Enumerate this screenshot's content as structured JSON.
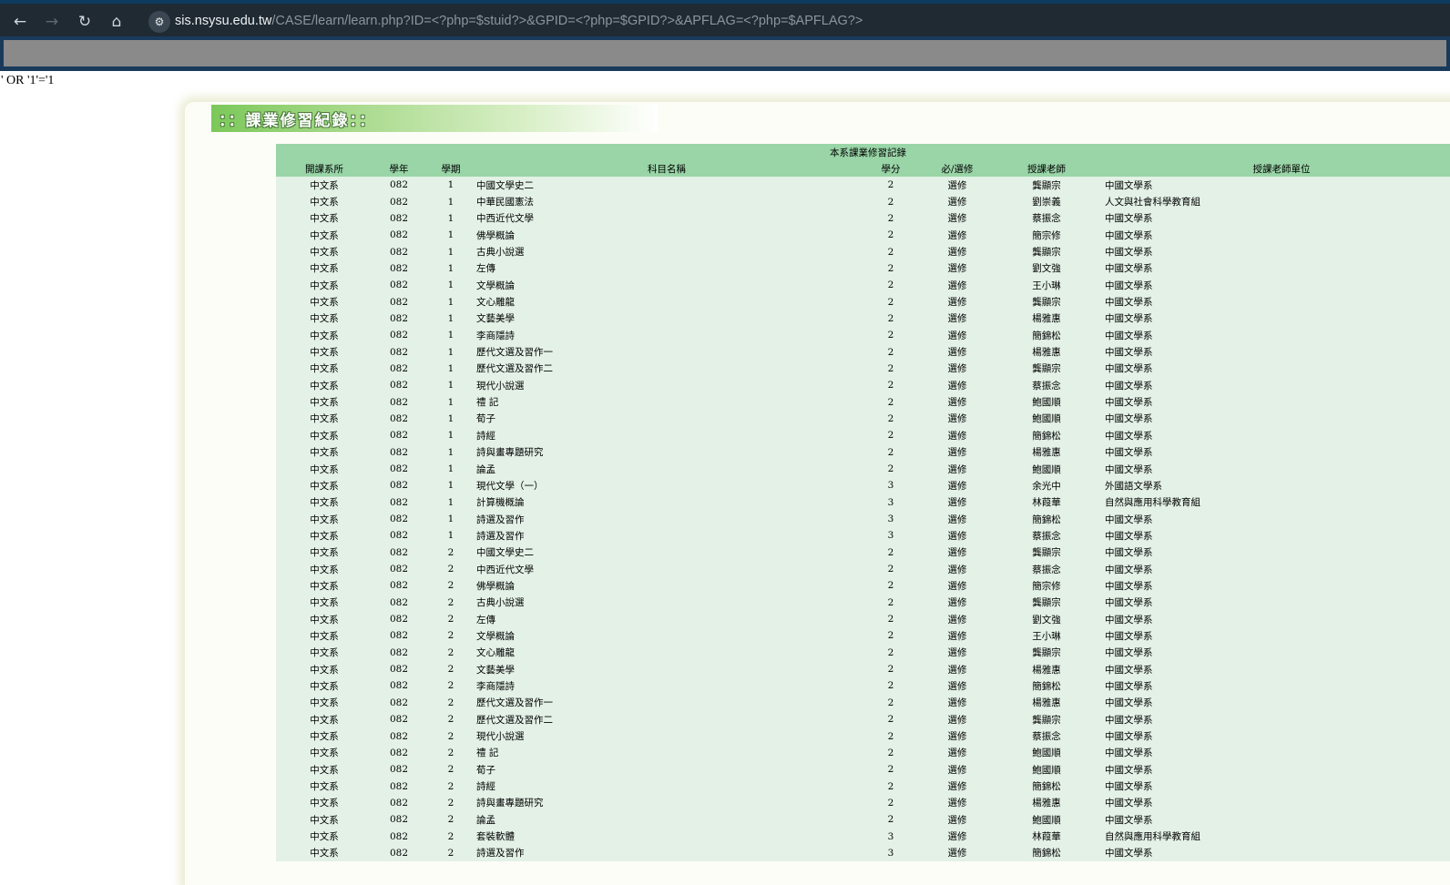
{
  "browser": {
    "url_host": "sis.nsysu.edu.tw",
    "url_path": "/CASE/learn/learn.php?ID=<?php=$stuid?>&GPID=<?php=$GPID?>&APFLAG=<?php=$APFLAG?>",
    "icons": [
      "back-arrow-icon",
      "forward-arrow-icon",
      "reload-icon",
      "home-icon",
      "site-settings-icon"
    ]
  },
  "page": {
    "sql_text": "' OR '1'='1",
    "banner_title": "：：課業修習紀錄：："
  },
  "table": {
    "caption": "本系課業修習記錄",
    "headers": [
      "開課系所",
      "學年",
      "學期",
      "科目名稱",
      "學分",
      "必/選修",
      "授課老師",
      "授課老師單位"
    ],
    "rows": [
      [
        "中文系",
        "082",
        "1",
        "中國文學史二",
        "2",
        "選修",
        "龔顯宗",
        "中國文學系"
      ],
      [
        "中文系",
        "082",
        "1",
        "中華民國憲法",
        "2",
        "選修",
        "劉崇義",
        "人文與社會科學教育組"
      ],
      [
        "中文系",
        "082",
        "1",
        "中西近代文學",
        "2",
        "選修",
        "蔡振念",
        "中國文學系"
      ],
      [
        "中文系",
        "082",
        "1",
        "佛學概論",
        "2",
        "選修",
        "簡宗修",
        "中國文學系"
      ],
      [
        "中文系",
        "082",
        "1",
        "古典小說選",
        "2",
        "選修",
        "龔顯宗",
        "中國文學系"
      ],
      [
        "中文系",
        "082",
        "1",
        "左傳",
        "2",
        "選修",
        "劉文強",
        "中國文學系"
      ],
      [
        "中文系",
        "082",
        "1",
        "文學概論",
        "2",
        "選修",
        "王小琳",
        "中國文學系"
      ],
      [
        "中文系",
        "082",
        "1",
        "文心雕龍",
        "2",
        "選修",
        "龔顯宗",
        "中國文學系"
      ],
      [
        "中文系",
        "082",
        "1",
        "文藝美學",
        "2",
        "選修",
        "楊雅惠",
        "中國文學系"
      ],
      [
        "中文系",
        "082",
        "1",
        "李商隱詩",
        "2",
        "選修",
        "簡錦松",
        "中國文學系"
      ],
      [
        "中文系",
        "082",
        "1",
        "歷代文選及習作一",
        "2",
        "選修",
        "楊雅惠",
        "中國文學系"
      ],
      [
        "中文系",
        "082",
        "1",
        "歷代文選及習作二",
        "2",
        "選修",
        "龔顯宗",
        "中國文學系"
      ],
      [
        "中文系",
        "082",
        "1",
        "現代小說選",
        "2",
        "選修",
        "蔡振念",
        "中國文學系"
      ],
      [
        "中文系",
        "082",
        "1",
        "禮 記",
        "2",
        "選修",
        "鮑國順",
        "中國文學系"
      ],
      [
        "中文系",
        "082",
        "1",
        "荀子",
        "2",
        "選修",
        "鮑國順",
        "中國文學系"
      ],
      [
        "中文系",
        "082",
        "1",
        "詩經",
        "2",
        "選修",
        "簡錦松",
        "中國文學系"
      ],
      [
        "中文系",
        "082",
        "1",
        "詩與畫專題研究",
        "2",
        "選修",
        "楊雅惠",
        "中國文學系"
      ],
      [
        "中文系",
        "082",
        "1",
        "論孟",
        "2",
        "選修",
        "鮑國順",
        "中國文學系"
      ],
      [
        "中文系",
        "082",
        "1",
        "現代文學（一）",
        "3",
        "選修",
        "余光中",
        "外國語文學系"
      ],
      [
        "中文系",
        "082",
        "1",
        "計算機概論",
        "3",
        "選修",
        "林葭華",
        "自然與應用科學教育組"
      ],
      [
        "中文系",
        "082",
        "1",
        "詩選及習作",
        "3",
        "選修",
        "簡錦松",
        "中國文學系"
      ],
      [
        "中文系",
        "082",
        "1",
        "詩選及習作",
        "3",
        "選修",
        "蔡振念",
        "中國文學系"
      ],
      [
        "中文系",
        "082",
        "2",
        "中國文學史二",
        "2",
        "選修",
        "龔顯宗",
        "中國文學系"
      ],
      [
        "中文系",
        "082",
        "2",
        "中西近代文學",
        "2",
        "選修",
        "蔡振念",
        "中國文學系"
      ],
      [
        "中文系",
        "082",
        "2",
        "佛學概論",
        "2",
        "選修",
        "簡宗修",
        "中國文學系"
      ],
      [
        "中文系",
        "082",
        "2",
        "古典小說選",
        "2",
        "選修",
        "龔顯宗",
        "中國文學系"
      ],
      [
        "中文系",
        "082",
        "2",
        "左傳",
        "2",
        "選修",
        "劉文強",
        "中國文學系"
      ],
      [
        "中文系",
        "082",
        "2",
        "文學概論",
        "2",
        "選修",
        "王小琳",
        "中國文學系"
      ],
      [
        "中文系",
        "082",
        "2",
        "文心雕龍",
        "2",
        "選修",
        "龔顯宗",
        "中國文學系"
      ],
      [
        "中文系",
        "082",
        "2",
        "文藝美學",
        "2",
        "選修",
        "楊雅惠",
        "中國文學系"
      ],
      [
        "中文系",
        "082",
        "2",
        "李商隱詩",
        "2",
        "選修",
        "簡錦松",
        "中國文學系"
      ],
      [
        "中文系",
        "082",
        "2",
        "歷代文選及習作一",
        "2",
        "選修",
        "楊雅惠",
        "中國文學系"
      ],
      [
        "中文系",
        "082",
        "2",
        "歷代文選及習作二",
        "2",
        "選修",
        "龔顯宗",
        "中國文學系"
      ],
      [
        "中文系",
        "082",
        "2",
        "現代小說選",
        "2",
        "選修",
        "蔡振念",
        "中國文學系"
      ],
      [
        "中文系",
        "082",
        "2",
        "禮 記",
        "2",
        "選修",
        "鮑國順",
        "中國文學系"
      ],
      [
        "中文系",
        "082",
        "2",
        "荀子",
        "2",
        "選修",
        "鮑國順",
        "中國文學系"
      ],
      [
        "中文系",
        "082",
        "2",
        "詩經",
        "2",
        "選修",
        "簡錦松",
        "中國文學系"
      ],
      [
        "中文系",
        "082",
        "2",
        "詩與畫專題研究",
        "2",
        "選修",
        "楊雅惠",
        "中國文學系"
      ],
      [
        "中文系",
        "082",
        "2",
        "論孟",
        "2",
        "選修",
        "鮑國順",
        "中國文學系"
      ],
      [
        "中文系",
        "082",
        "2",
        "套裝軟體",
        "3",
        "選修",
        "林葭華",
        "自然與應用科學教育組"
      ],
      [
        "中文系",
        "082",
        "2",
        "詩選及習作",
        "3",
        "選修",
        "簡錦松",
        "中國文學系"
      ]
    ]
  },
  "colors": {
    "header_green": "#99d5a7",
    "row_green": "#e3f1e6",
    "banner_green": "#7cc85a"
  }
}
